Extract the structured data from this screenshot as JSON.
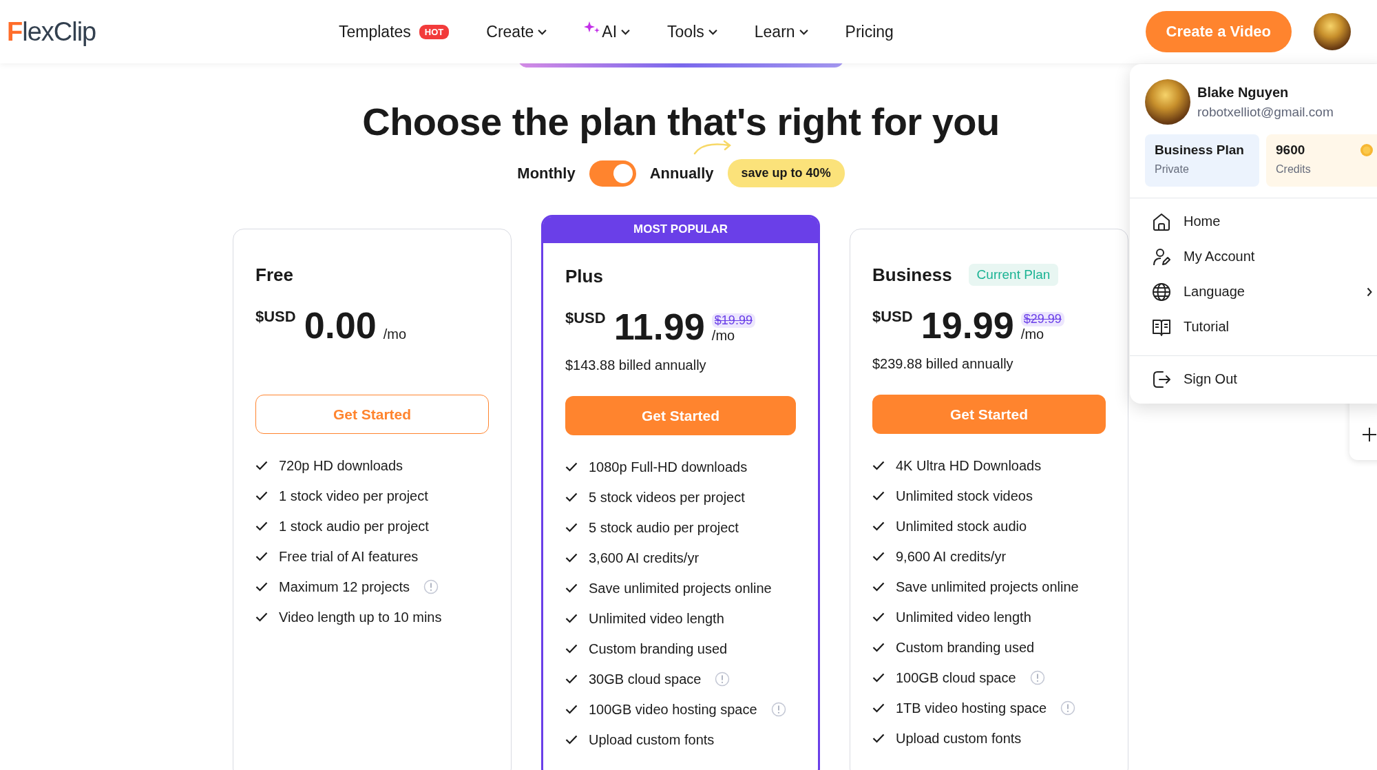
{
  "header": {
    "logo": "FlexClip",
    "nav": [
      {
        "label": "Templates",
        "kind": "link",
        "badge": "HOT",
        "dropdown": false
      },
      {
        "label": "Create",
        "kind": "link",
        "dropdown": true
      },
      {
        "label": "AI",
        "kind": "ai",
        "dropdown": true
      },
      {
        "label": "Tools",
        "kind": "link",
        "dropdown": true
      },
      {
        "label": "Learn",
        "kind": "link",
        "dropdown": true
      },
      {
        "label": "Pricing",
        "kind": "link",
        "dropdown": false
      }
    ],
    "cta": "Create a Video"
  },
  "title": "Choose the plan that's right for you",
  "billing": {
    "options": [
      "Monthly",
      "Annually"
    ],
    "annual": true,
    "promo": "save up to 40%"
  },
  "plans": [
    {
      "name": "Free",
      "currency": "$USD",
      "price": "0.00",
      "period": "/mo",
      "button": "Get Started",
      "kind": "outline",
      "highlighted": false,
      "features": [
        {
          "text": "720p HD downloads",
          "info": false
        },
        {
          "text": "1 stock video per project",
          "info": false
        },
        {
          "text": "1 stock audio per project",
          "info": false
        },
        {
          "text": "Free trial of AI features",
          "info": false
        },
        {
          "text": "Maximum 12 projects",
          "info": true
        },
        {
          "text": "Video length up to 10 mins",
          "info": false
        }
      ]
    },
    {
      "name": "Plus",
      "ribbon": "MOST POPULAR",
      "currency": "$USD",
      "price": "11.99",
      "original_price": "$19.99",
      "period": "/mo",
      "billed": "$143.88 billed annually",
      "button": "Get Started",
      "kind": "filled",
      "highlighted": true,
      "features": [
        {
          "text": "1080p Full-HD downloads",
          "info": false
        },
        {
          "text": "5 stock videos per project",
          "info": false
        },
        {
          "text": "5 stock audio per project",
          "info": false
        },
        {
          "text": "3,600 AI credits/yr",
          "info": false
        },
        {
          "text": "Save unlimited projects online",
          "info": false
        },
        {
          "text": "Unlimited video length",
          "info": false
        },
        {
          "text": "Custom branding used",
          "info": false
        },
        {
          "text": "30GB cloud space",
          "info": true
        },
        {
          "text": "100GB video hosting space",
          "info": true
        },
        {
          "text": "Upload custom fonts",
          "info": false
        }
      ]
    },
    {
      "name": "Business",
      "badge": "Current Plan",
      "currency": "$USD",
      "price": "19.99",
      "original_price": "$29.99",
      "period": "/mo",
      "billed": "$239.88 billed annually",
      "button": "Get Started",
      "kind": "filled",
      "highlighted": false,
      "features": [
        {
          "text": "4K Ultra HD Downloads",
          "info": false
        },
        {
          "text": "Unlimited stock videos",
          "info": false
        },
        {
          "text": "Unlimited stock audio",
          "info": false
        },
        {
          "text": "9,600 AI credits/yr",
          "info": false
        },
        {
          "text": "Save unlimited projects online",
          "info": false
        },
        {
          "text": "Unlimited video length",
          "info": false
        },
        {
          "text": "Custom branding used",
          "info": false
        },
        {
          "text": "100GB cloud space",
          "info": true
        },
        {
          "text": "1TB video hosting space",
          "info": true
        },
        {
          "text": "Upload custom fonts",
          "info": false
        }
      ]
    }
  ],
  "account_menu": {
    "name": "Blake Nguyen",
    "email": "robotxelliot@gmail.com",
    "plan": {
      "title": "Business Plan",
      "subtitle": "Private"
    },
    "credits": {
      "value": "9600",
      "label": "Credits"
    },
    "items": [
      {
        "label": "Home",
        "kind": "home",
        "submenu": false
      },
      {
        "label": "My Account",
        "kind": "account",
        "submenu": false
      },
      {
        "label": "Language",
        "kind": "language",
        "submenu": true
      },
      {
        "label": "Tutorial",
        "kind": "tutorial",
        "submenu": false
      }
    ],
    "sign_out": "Sign Out"
  }
}
